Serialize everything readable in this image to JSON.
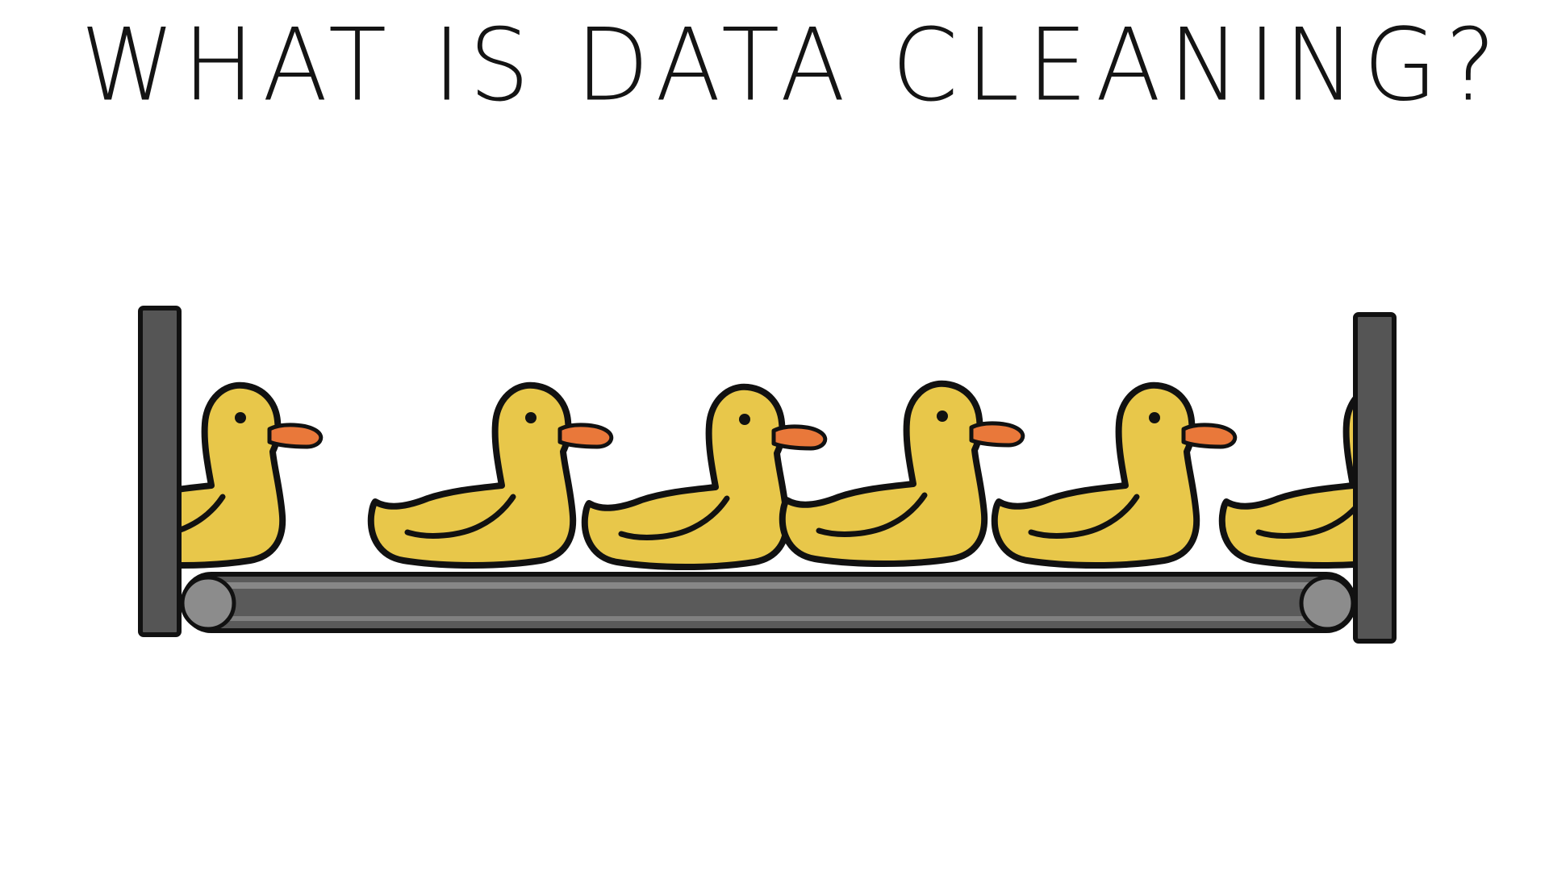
{
  "slide": {
    "title": "WHAT IS DATA CLEANING?"
  },
  "illustration": {
    "duck_count": 6,
    "colors": {
      "duck_body": "#E8C74A",
      "duck_wing": "#D6B23C",
      "duck_beak": "#E9783A",
      "outline": "#111111",
      "belt": "#5A5A5A",
      "post": "#555555",
      "roller": "#8C8C8C"
    }
  }
}
